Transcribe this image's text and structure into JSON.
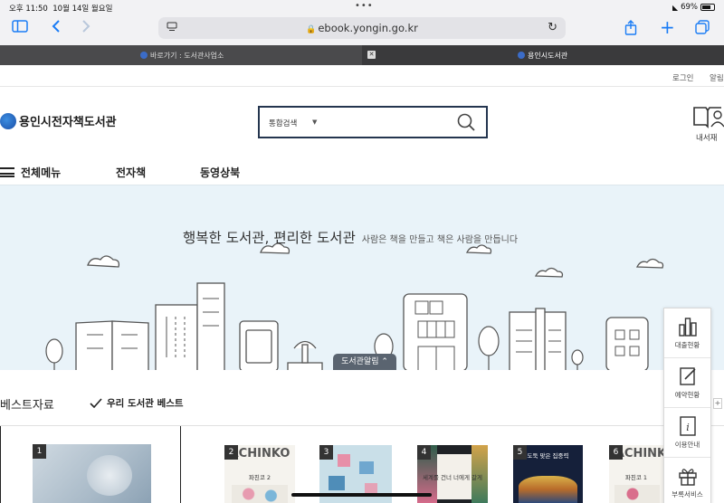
{
  "status": {
    "time": "오후 11:50",
    "date": "10월 14일 월요일",
    "battery": "69%"
  },
  "browser": {
    "url": "ebook.yongin.go.kr",
    "tabs": [
      {
        "label": "바로가기 : 도서관사업소",
        "active": true
      },
      {
        "label": "용인시도서관",
        "active": false
      }
    ]
  },
  "util": {
    "login": "로그인",
    "alarm": "알림"
  },
  "header": {
    "logo": "용인시전자책도서관",
    "search_select": "통합검색",
    "mybook": "내서재"
  },
  "nav": {
    "menu": "전체메뉴",
    "items": [
      "전자책",
      "동영상북"
    ]
  },
  "banner": {
    "title": "행복한 도서관, 편리한 도서관",
    "subtitle": "사람은 책을 만들고 책은 사람을 만듭니다",
    "notice_tab": "도서관알림"
  },
  "best": {
    "title": "베스트자료",
    "tab": "우리 도서관 베스트",
    "books": [
      {
        "rank": "1"
      },
      {
        "rank": "2",
        "cover_text": "ACHINKO",
        "sub": "파친코 2"
      },
      {
        "rank": "3"
      },
      {
        "rank": "4",
        "sub": "세계를 건너 너에게 갈게"
      },
      {
        "rank": "5",
        "sub": "도둑 맞은 집중력"
      },
      {
        "rank": "6",
        "cover_text": "ACHINK",
        "sub": "파친코 1"
      }
    ]
  },
  "quick_menu": [
    "대출현황",
    "예약현황",
    "이용안내",
    "부록서비스"
  ],
  "colors": {
    "accent": "#1a7cf5",
    "search_border": "#24354f",
    "banner_bg": "#e9f3f9"
  }
}
